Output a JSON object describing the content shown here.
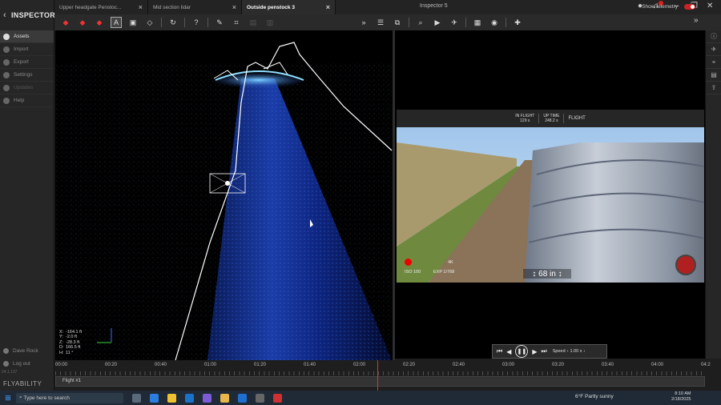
{
  "app": {
    "brand": "INSPECTOR",
    "window_title": "Inspector 5",
    "logo_text": "FLYABILITY",
    "version": "24.1.137"
  },
  "sidebar": {
    "items": [
      {
        "label": "Assets",
        "active": true
      },
      {
        "label": "Import",
        "active": false
      },
      {
        "label": "Export",
        "active": false
      },
      {
        "label": "Settings",
        "active": false
      },
      {
        "label": "Updates",
        "active": false
      },
      {
        "label": "Help",
        "active": false
      }
    ],
    "user": "Dave Rock",
    "logout": "Log out"
  },
  "tabs": [
    {
      "label": "Upper headgate Penstoc...",
      "active": false
    },
    {
      "label": "Mid section lidar",
      "active": false
    },
    {
      "label": "Outside penstock 3",
      "active": true
    }
  ],
  "toolbar": {
    "telemetry_label": "Show telemetry",
    "telemetry_on": true,
    "icons": [
      "cube-red-icon",
      "cube-red-icon",
      "cube-red-icon",
      "text-a-icon",
      "frame-icon",
      "cube-outline-icon",
      "rotate-icon",
      "help-icon",
      "pen-icon",
      "polygon-icon",
      "save-icon",
      "trash-icon",
      "chevrons-right-icon",
      "sliders-icon",
      "layers-icon",
      "zoom-icon",
      "video-icon",
      "drone-icon",
      "calendar-icon",
      "camera-icon",
      "marker-icon"
    ]
  },
  "viewport": {
    "coords": [
      {
        "k": "X:",
        "v": "-164.1 ft"
      },
      {
        "k": "Y:",
        "v": "-2.0 ft"
      },
      {
        "k": "Z:",
        "v": "-28.3 ft"
      },
      {
        "k": "D:",
        "v": "166.5 ft"
      },
      {
        "k": "H:",
        "v": "11 °"
      }
    ]
  },
  "video": {
    "status": [
      {
        "top": "IN FLIGHT",
        "bottom": "129 s"
      },
      {
        "top": "UP TIME",
        "bottom": "248.2 s"
      }
    ],
    "mode": "FLIGHT",
    "resolution": "4K",
    "iso": "ISO 100",
    "exposure": "EXP 1/768",
    "range": "68 in"
  },
  "player": {
    "speed_label": "Speed",
    "speed_value": "1.00 x"
  },
  "timeline": {
    "ticks": [
      "00:00",
      "00:20",
      "00:40",
      "01:00",
      "01:20",
      "01:40",
      "02:00",
      "02:20",
      "02:40",
      "03:00",
      "03:20",
      "03:40",
      "04:00",
      "04:2"
    ],
    "track_label": "Flight #1"
  },
  "taskbar": {
    "search_placeholder": "Type here to search",
    "weather": "6°F  Partly sunny",
    "time": "8:10 AM",
    "date": "2/18/2025"
  }
}
